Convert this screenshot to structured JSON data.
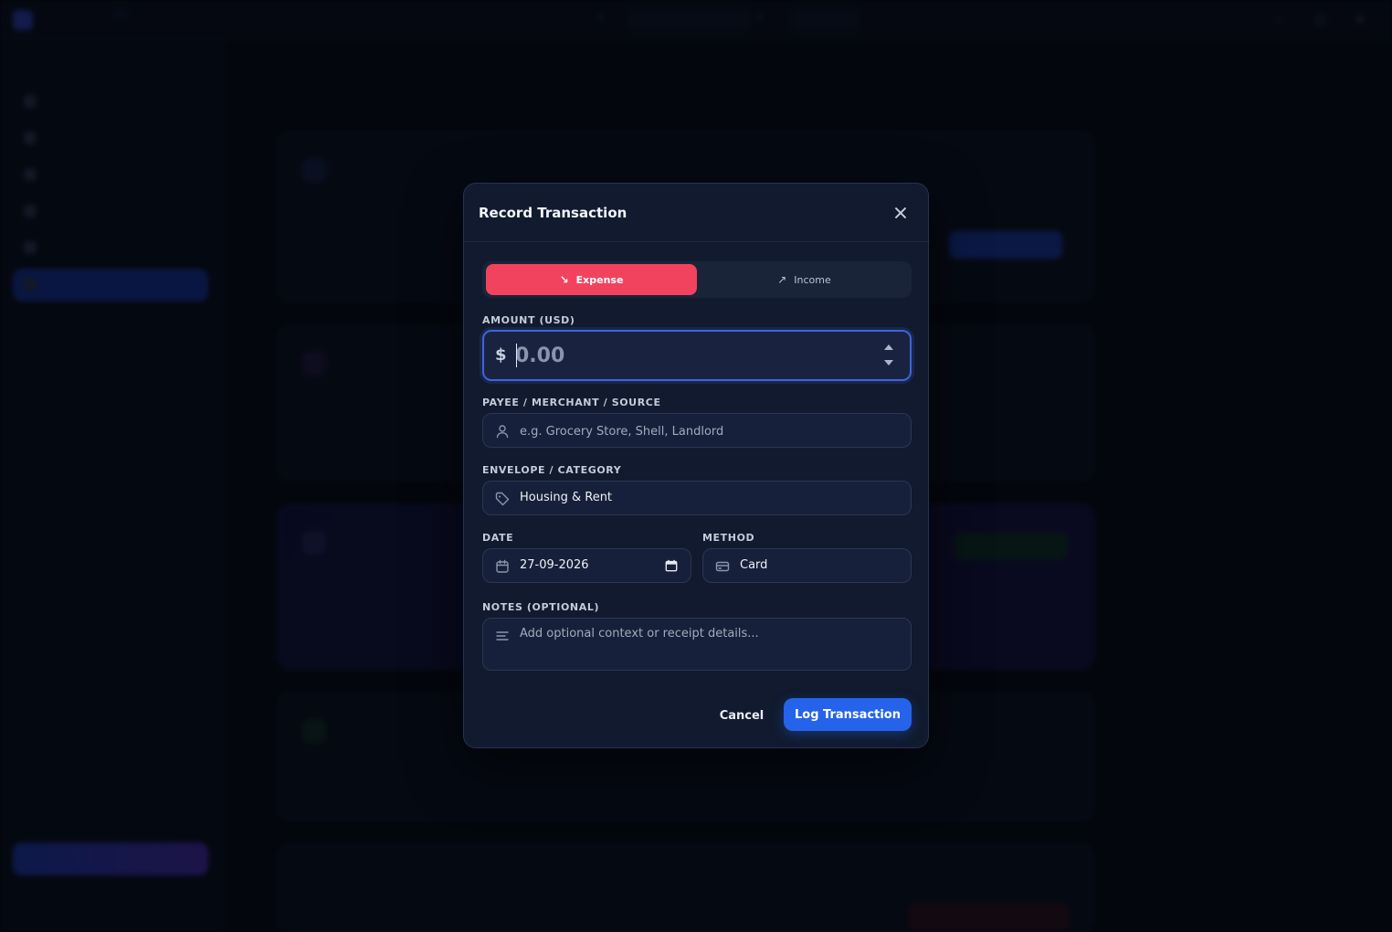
{
  "modal": {
    "title": "Record Transaction",
    "type_toggle": {
      "expense_label": "Expense",
      "income_label": "Income",
      "selected": "Expense"
    },
    "amount": {
      "label": "AMOUNT (USD)",
      "currency_symbol": "$",
      "placeholder": "0.00"
    },
    "payee": {
      "label": "PAYEE / MERCHANT / SOURCE",
      "placeholder": "e.g. Grocery Store, Shell, Landlord"
    },
    "envelope": {
      "label": "ENVELOPE / CATEGORY",
      "value": "Housing & Rent"
    },
    "date": {
      "label": "DATE",
      "value": "27-09-2026"
    },
    "method": {
      "label": "METHOD",
      "value": "Card"
    },
    "notes": {
      "label": "NOTES (OPTIONAL)",
      "placeholder": "Add optional context or receipt details..."
    },
    "cancel_label": "Cancel",
    "submit_label": "Log Transaction"
  },
  "colors": {
    "expense_accent": "#f2435e",
    "primary": "#2563eb",
    "modal_bg": "#111a2e",
    "field_bg": "#17203a"
  }
}
